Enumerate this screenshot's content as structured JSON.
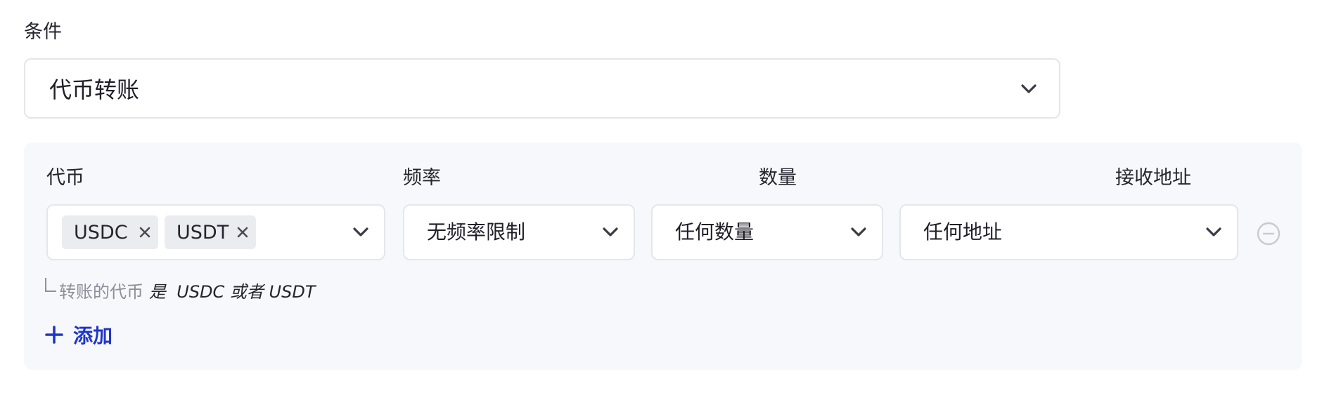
{
  "section": {
    "label": "条件"
  },
  "condition_select": {
    "value": "代币转账",
    "icon": "chevron-down-icon"
  },
  "rule": {
    "columns": {
      "token": "代币",
      "frequency": "频率",
      "amount": "数量",
      "recipient": "接收地址"
    },
    "token_tags": [
      "USDC",
      "USDT"
    ],
    "frequency_value": "无频率限制",
    "amount_value": "任何数量",
    "recipient_value": "任何地址",
    "hint": {
      "prefix": "转账的代币",
      "text": "是  USDC 或者 USDT"
    }
  },
  "actions": {
    "add_label": "添加"
  },
  "colors": {
    "accent": "#1f36c7",
    "panel_bg": "#f7f8fb",
    "border": "#e5e6eb",
    "tag_bg": "#ebecf0",
    "muted_text": "#8d8f9a"
  }
}
